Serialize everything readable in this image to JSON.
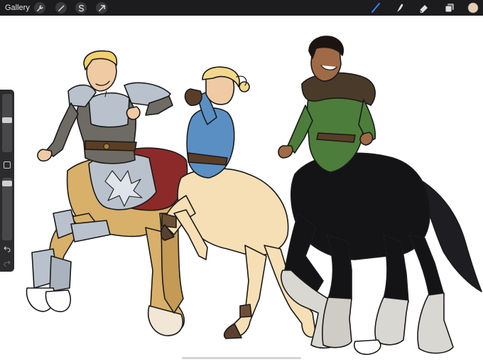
{
  "app": {
    "gallery_label": "Gallery"
  },
  "toolbar": {
    "left_icons": [
      "wrench-icon",
      "magic-wand-icon",
      "selection-s-icon",
      "arrow-transform-icon"
    ],
    "right_icons": [
      "brush-icon",
      "smudge-icon",
      "eraser-icon",
      "layers-icon",
      "color-swatch"
    ],
    "active_tool": "brush",
    "accent_color": "#3b82f6",
    "current_color": "#e8cdb5"
  },
  "sidebar": {
    "brush_size_level": 0.55,
    "opacity_level": 0.95,
    "buttons": [
      "modify-square-icon",
      "undo-icon",
      "redo-icon"
    ]
  },
  "colors": {
    "topbar": "#1c1c1e",
    "sidebar": "#2c2c2e",
    "canvas": "#ffffff"
  }
}
